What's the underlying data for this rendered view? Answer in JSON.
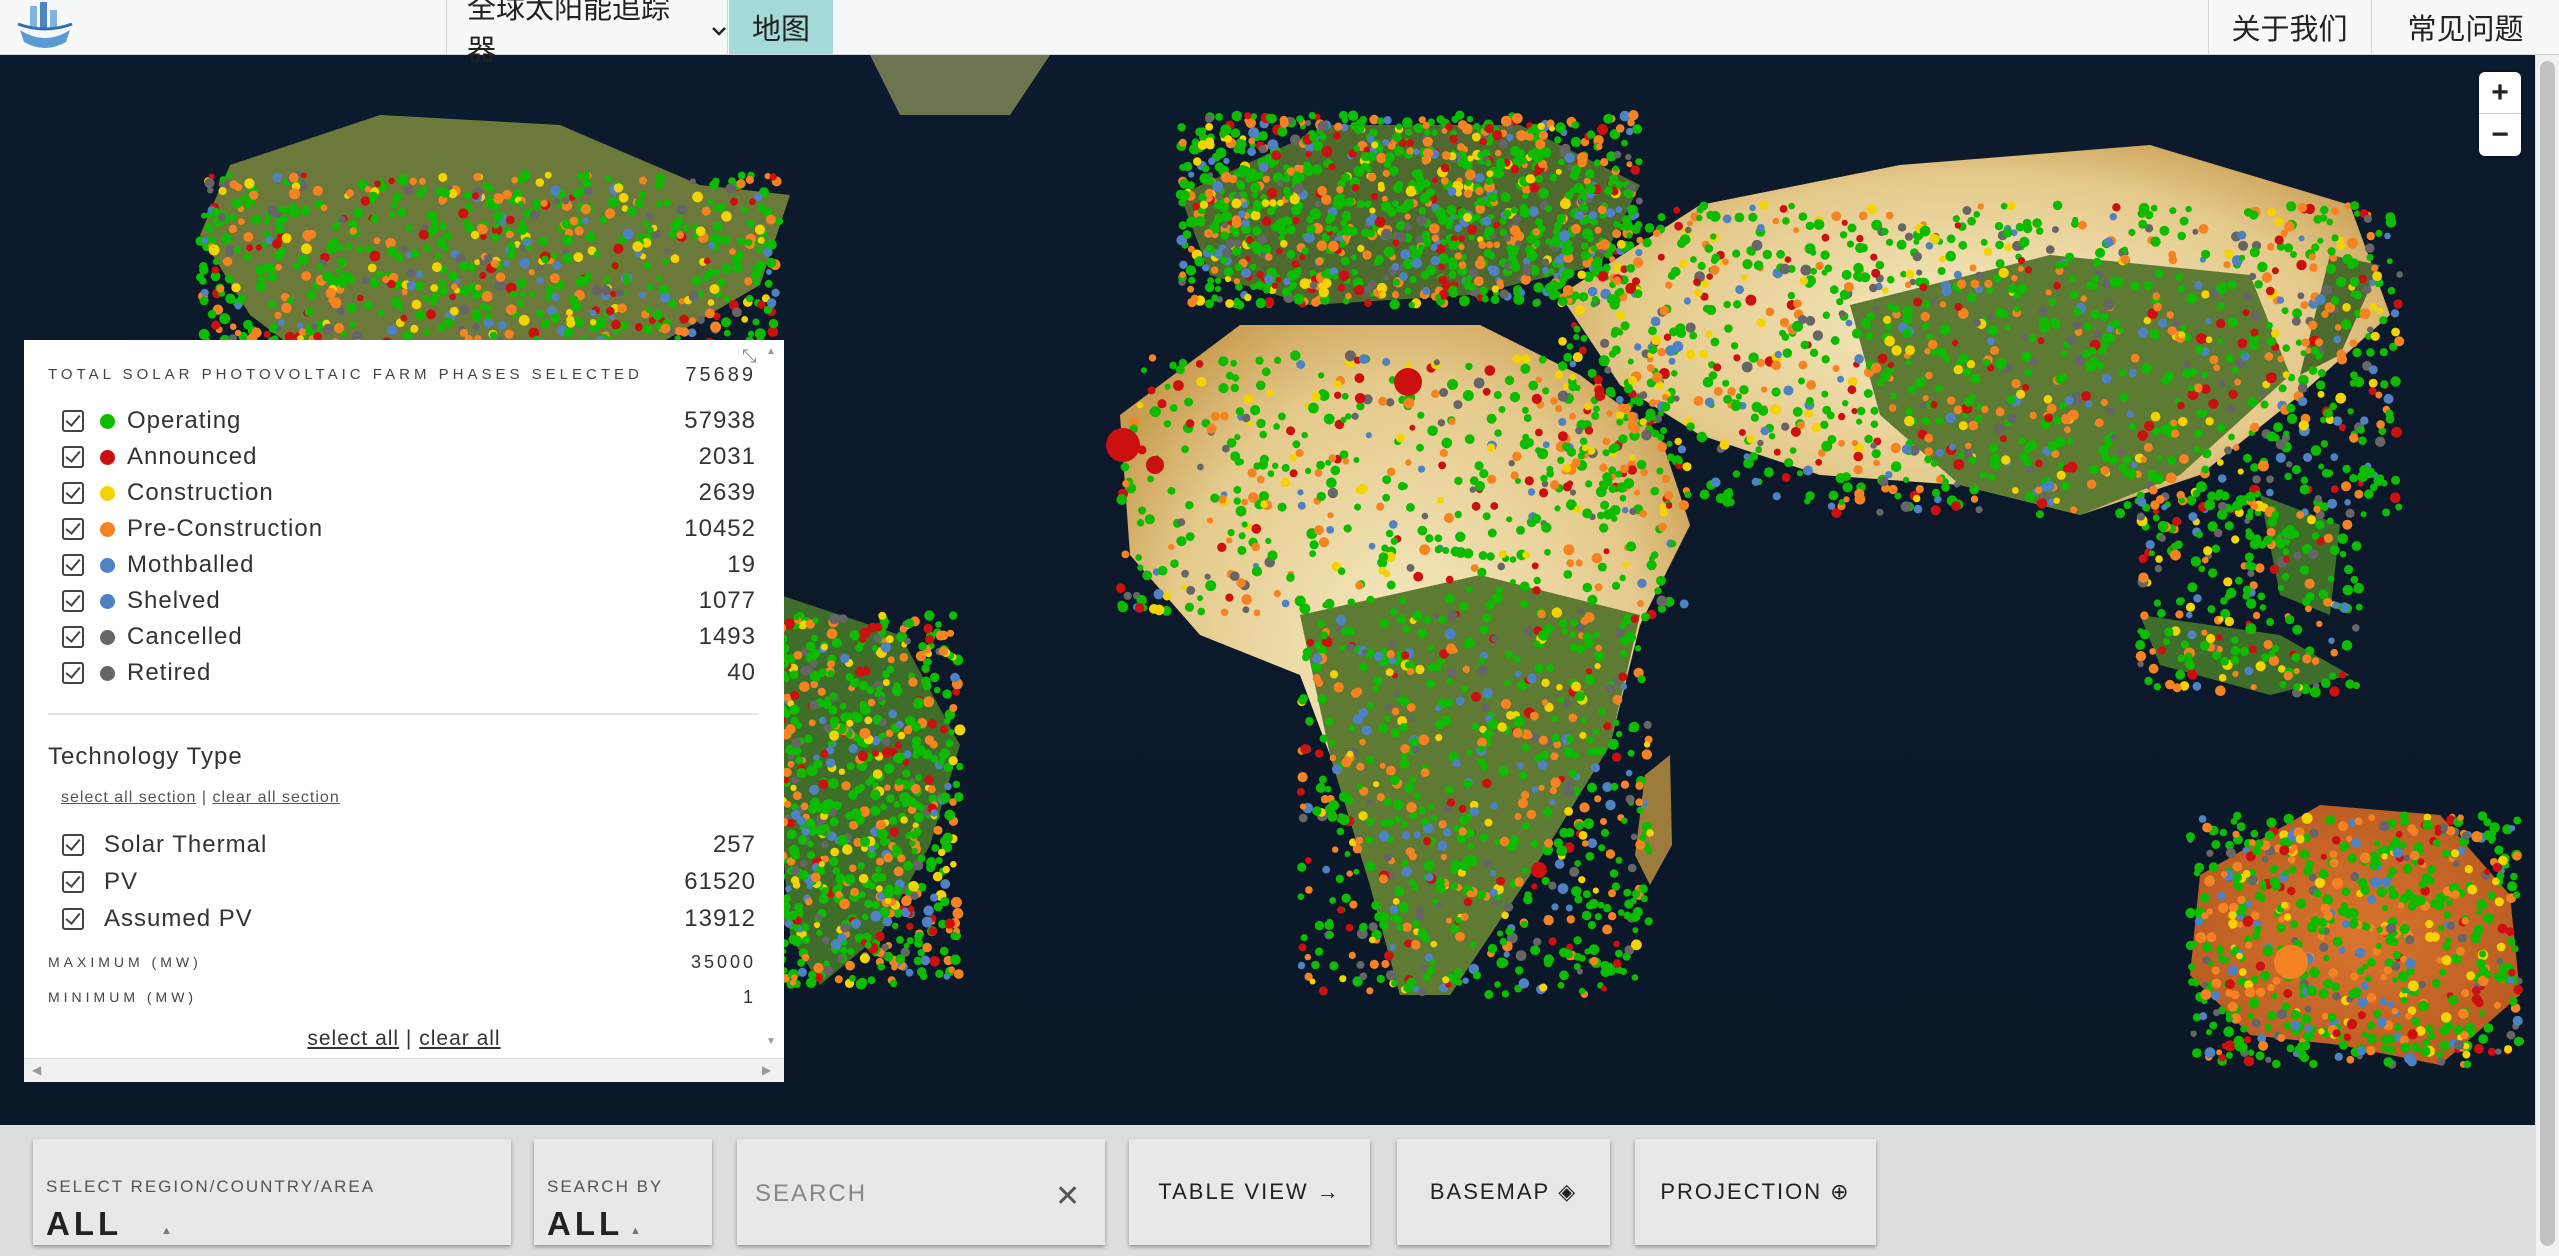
{
  "nav": {
    "tracker_label": "全球太阳能追踪器",
    "map_tab": "地图",
    "about": "关于我们",
    "faq": "常见问题",
    "chevron_icon": "chevron-down-icon",
    "logo_icon": "logo-icon"
  },
  "map": {
    "zoom_in": "+",
    "zoom_out": "−",
    "status_colors": {
      "operating": "#0dbb00",
      "announced": "#cc1010",
      "construction": "#f3d400",
      "pre_construction": "#f58322",
      "mothballed": "#4f82c2",
      "shelved": "#4f82c2",
      "cancelled": "#666666",
      "retired": "#666666"
    }
  },
  "panel": {
    "header": "TOTAL SOLAR PHOTOVOLTAIC FARM PHASES SELECTED",
    "total": "75689",
    "statuses": [
      {
        "label": "Operating",
        "count": "57938",
        "color": "#0dbb00"
      },
      {
        "label": "Announced",
        "count": "2031",
        "color": "#cc1010"
      },
      {
        "label": "Construction",
        "count": "2639",
        "color": "#f3d400"
      },
      {
        "label": "Pre-Construction",
        "count": "10452",
        "color": "#f58322"
      },
      {
        "label": "Mothballed",
        "count": "19",
        "color": "#4f82c2"
      },
      {
        "label": "Shelved",
        "count": "1077",
        "color": "#4f82c2"
      },
      {
        "label": "Cancelled",
        "count": "1493",
        "color": "#666666"
      },
      {
        "label": "Retired",
        "count": "40",
        "color": "#666666"
      }
    ],
    "tech_title": "Technology Type",
    "select_all_section": "select all section",
    "separator": "|",
    "clear_all_section": "clear all section",
    "technologies": [
      {
        "label": "Solar Thermal",
        "count": "257"
      },
      {
        "label": "PV",
        "count": "61520"
      },
      {
        "label": "Assumed PV",
        "count": "13912"
      }
    ],
    "max_label": "MAXIMUM (MW)",
    "max_value": "35000",
    "min_label": "MINIMUM (MW)",
    "min_value": "1",
    "select_all": "select all",
    "clear_all": "clear all"
  },
  "bottom": {
    "region_label": "SELECT REGION/COUNTRY/AREA",
    "region_value": "ALL",
    "searchby_label": "SEARCH BY",
    "searchby_value": "ALL",
    "search_placeholder": "SEARCH",
    "table_view": "TABLE VIEW",
    "table_icon": "→",
    "basemap": "BASEMAP",
    "basemap_icon": "◈",
    "projection": "PROJECTION",
    "projection_icon": "⊕"
  }
}
